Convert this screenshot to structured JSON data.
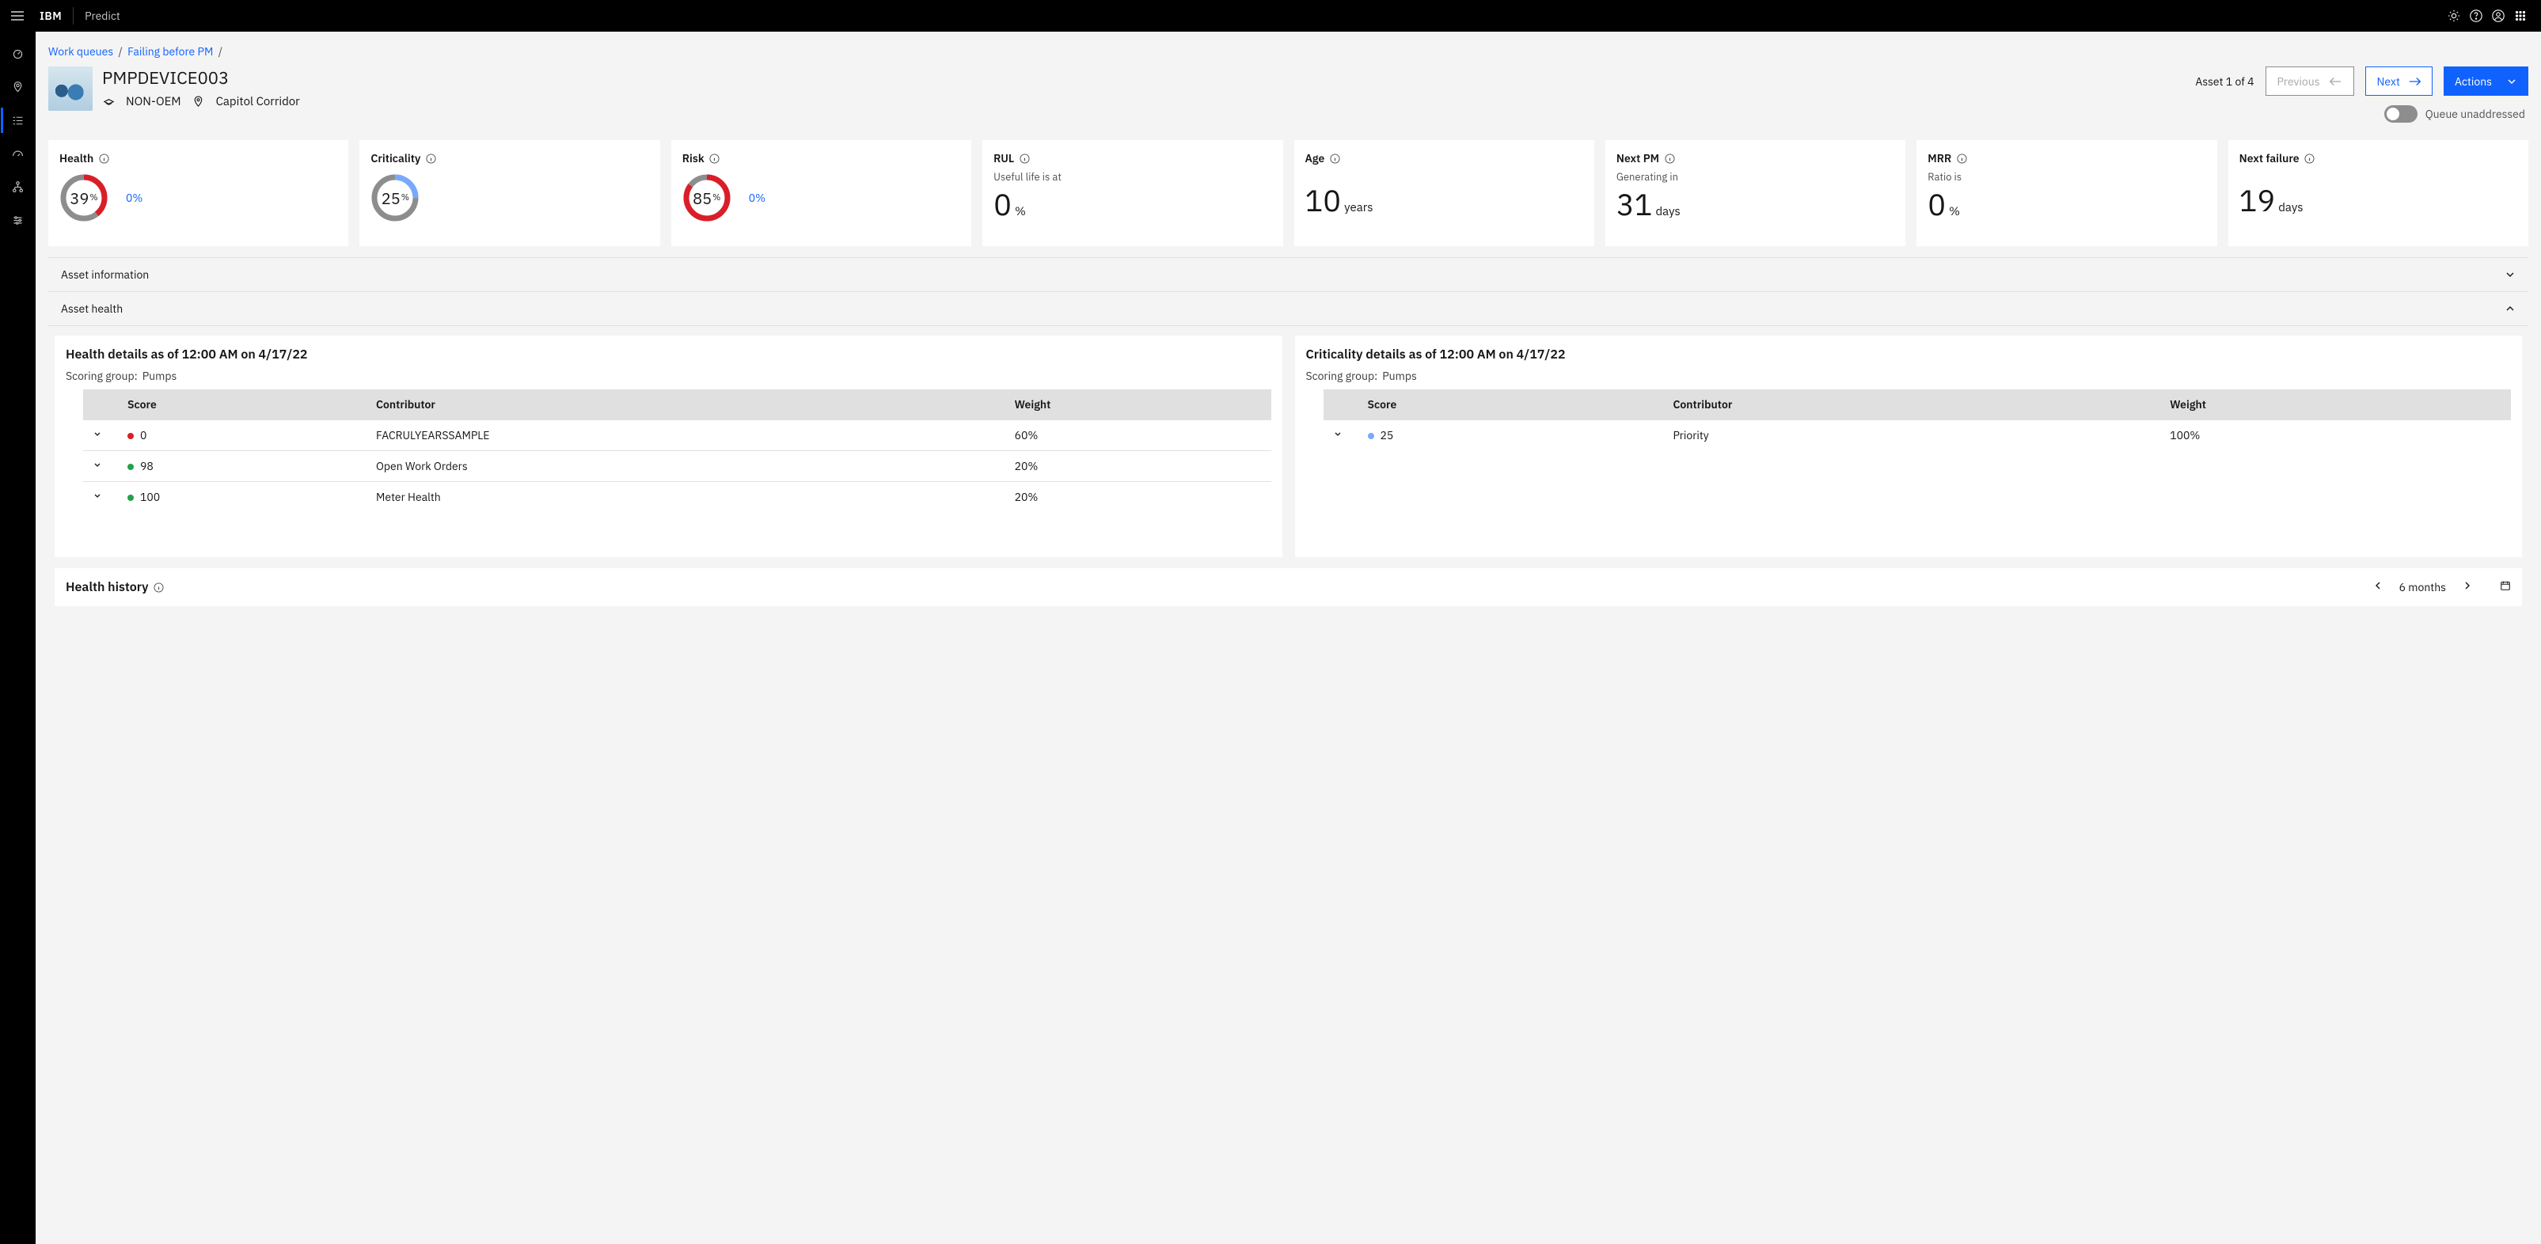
{
  "topbar": {
    "brand": "IBM",
    "product": "Predict"
  },
  "breadcrumbs": {
    "a": "Work queues",
    "b": "Failing before PM"
  },
  "asset": {
    "title": "PMPDEVICE003",
    "oem": "NON-OEM",
    "location": "Capitol Corridor",
    "pager": "Asset 1 of 4",
    "prev": "Previous",
    "next": "Next",
    "actions": "Actions",
    "toggle": "Queue unaddressed"
  },
  "kpi": {
    "health": {
      "label": "Health",
      "value": "39",
      "pct": "%",
      "delta": "0%"
    },
    "criticality": {
      "label": "Criticality",
      "value": "25",
      "pct": "%"
    },
    "risk": {
      "label": "Risk",
      "value": "85",
      "pct": "%",
      "delta": "0%"
    },
    "rul": {
      "label": "RUL",
      "sub": "Useful life is at",
      "big": "0",
      "unit": "%"
    },
    "age": {
      "label": "Age",
      "big": "10",
      "unit": "years"
    },
    "nextpm": {
      "label": "Next PM",
      "sub": "Generating in",
      "big": "31",
      "unit": "days"
    },
    "mrr": {
      "label": "MRR",
      "sub": "Ratio is",
      "big": "0",
      "unit": "%"
    },
    "nextfail": {
      "label": "Next failure",
      "big": "19",
      "unit": "days"
    }
  },
  "acc": {
    "info": "Asset information",
    "health": "Asset health"
  },
  "health_panel": {
    "title": "Health details as of 12:00 AM on 4/17/22",
    "sg_label": "Scoring group:",
    "sg_value": "Pumps",
    "th_score": "Score",
    "th_contrib": "Contributor",
    "th_weight": "Weight",
    "r1": {
      "score": "0",
      "contrib": "FACRULYEARSSAMPLE",
      "weight": "60%"
    },
    "r2": {
      "score": "98",
      "contrib": "Open Work Orders",
      "weight": "20%"
    },
    "r3": {
      "score": "100",
      "contrib": "Meter Health",
      "weight": "20%"
    }
  },
  "crit_panel": {
    "title": "Criticality details as of 12:00 AM on 4/17/22",
    "sg_label": "Scoring group:",
    "sg_value": "Pumps",
    "th_score": "Score",
    "th_contrib": "Contributor",
    "th_weight": "Weight",
    "r1": {
      "score": "25",
      "contrib": "Priority",
      "weight": "100%"
    }
  },
  "history": {
    "title": "Health history",
    "range": "6 months"
  }
}
